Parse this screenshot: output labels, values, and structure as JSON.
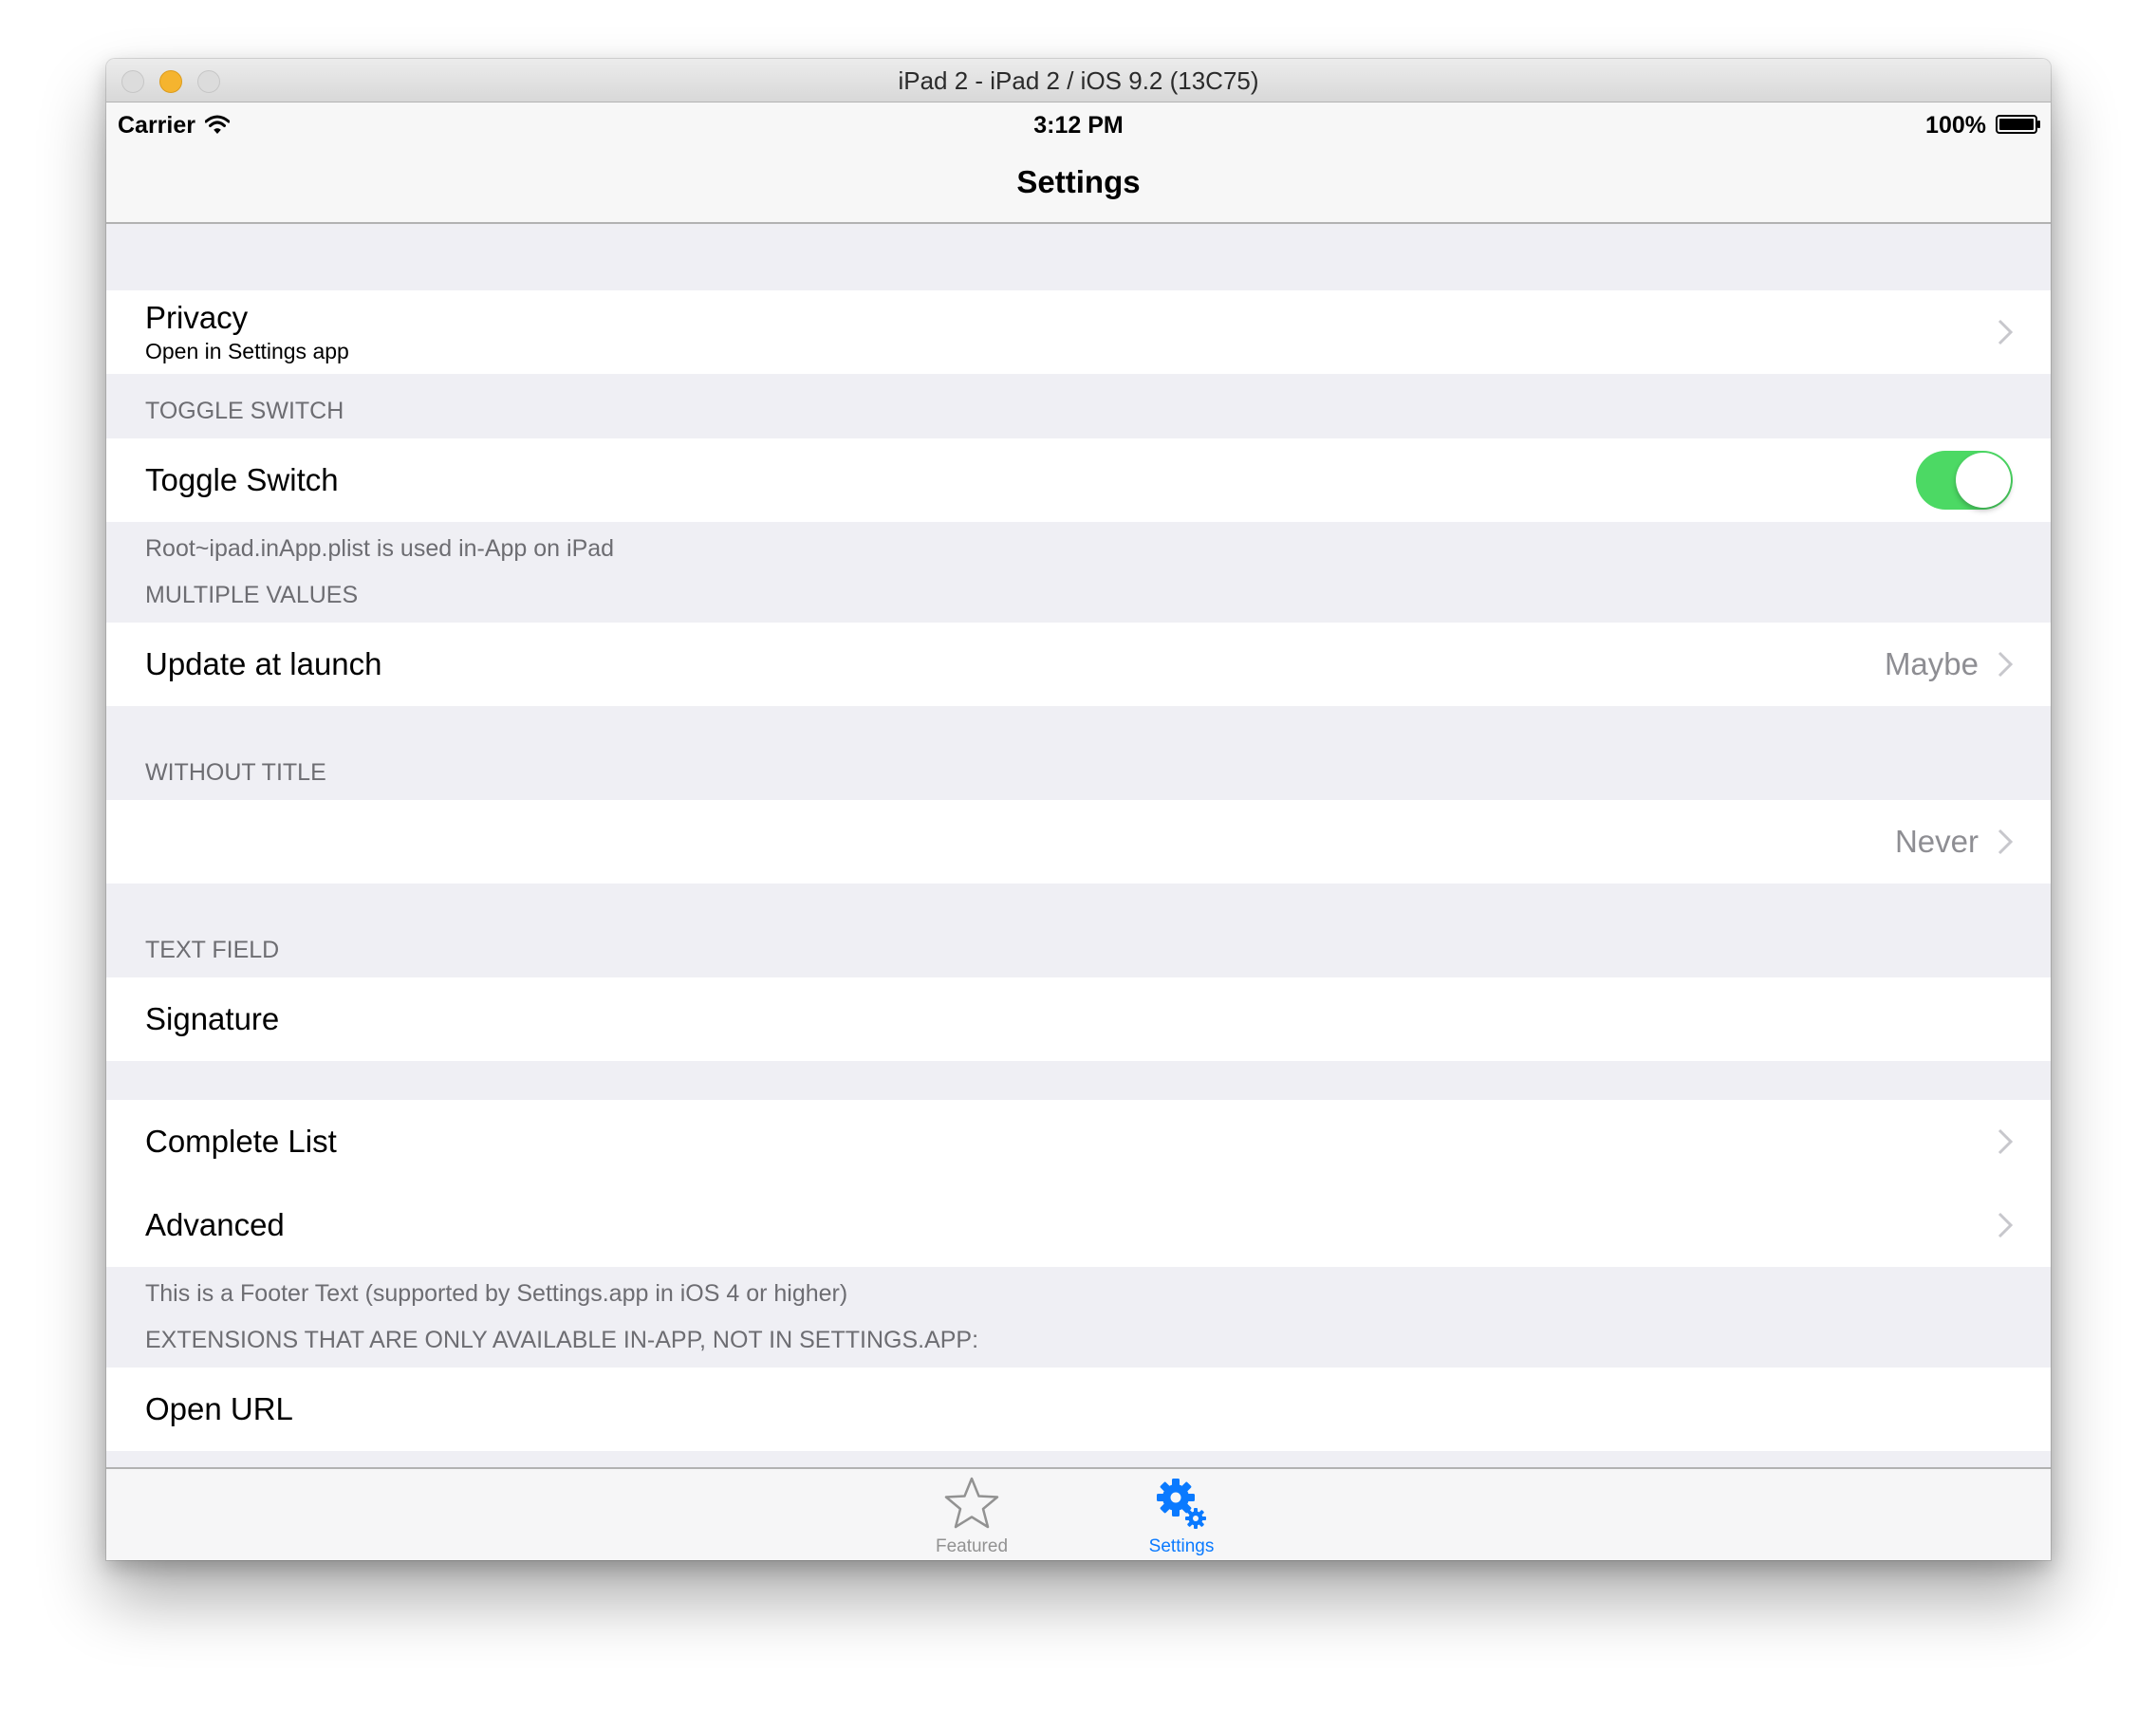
{
  "window": {
    "title": "iPad 2 - iPad 2 / iOS 9.2 (13C75)"
  },
  "status_bar": {
    "carrier": "Carrier",
    "time": "3:12 PM",
    "battery": "100%"
  },
  "nav": {
    "title": "Settings"
  },
  "sections": {
    "privacy": {
      "title": "Privacy",
      "subtitle": "Open in Settings app"
    },
    "toggle": {
      "header": "TOGGLE SWITCH",
      "label": "Toggle Switch",
      "state": "on",
      "footer": "Root~ipad.inApp.plist is used in-App on iPad"
    },
    "multiple_values": {
      "header": "MULTIPLE VALUES",
      "label": "Update at launch",
      "value": "Maybe"
    },
    "without_title": {
      "header": "WITHOUT TITLE",
      "value": "Never"
    },
    "text_field": {
      "header": "TEXT FIELD",
      "label": "Signature"
    },
    "lists": {
      "complete_list": "Complete List",
      "advanced": "Advanced",
      "footer": "This is a Footer Text (supported by Settings.app in iOS 4 or higher)"
    },
    "extensions": {
      "header": "EXTENSIONS THAT ARE ONLY AVAILABLE IN-APP, NOT IN SETTINGS.APP:",
      "partial_cell": "Open URL"
    }
  },
  "tabbar": {
    "items": [
      {
        "label": "Featured",
        "icon": "star-icon",
        "selected": false
      },
      {
        "label": "Settings",
        "icon": "gears-icon",
        "selected": true
      }
    ]
  },
  "colors": {
    "accent": "#0a7aff",
    "toggle_on": "#4cd964",
    "group_background": "#efeff4",
    "secondary_text": "#6d6d72",
    "value_text": "#8e8e93"
  }
}
